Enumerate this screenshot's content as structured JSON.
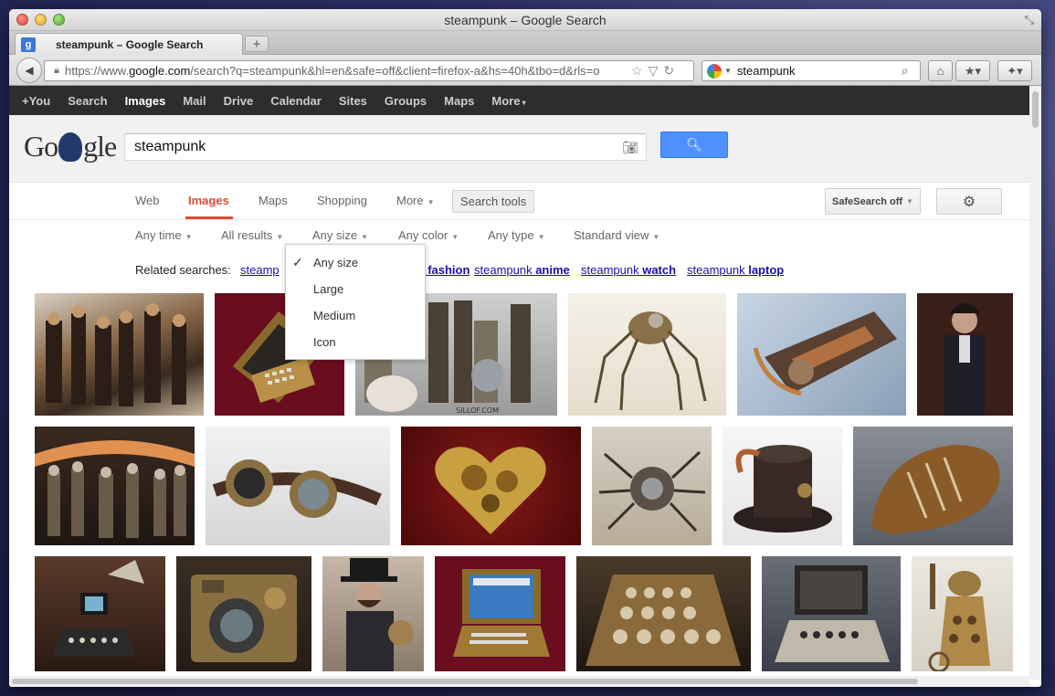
{
  "window": {
    "title": "steampunk – Google Search"
  },
  "tab": {
    "label": "steampunk – Google Search",
    "favicon": "g"
  },
  "navbar": {
    "url_prefix": "https://www.",
    "url_host": "google.com",
    "url_rest": "/search?q=steampunk&hl=en&safe=off&client=firefox-a&hs=40h&tbo=d&rls=o",
    "search_value": "steampunk"
  },
  "gbar": {
    "items": [
      "+You",
      "Search",
      "Images",
      "Mail",
      "Drive",
      "Calendar",
      "Sites",
      "Groups",
      "Maps",
      "More"
    ],
    "active": "Images"
  },
  "header": {
    "logo_pre": "Go",
    "logo_post": "gle",
    "query": "steampunk"
  },
  "searchnav": {
    "web": "Web",
    "images": "Images",
    "maps": "Maps",
    "shopping": "Shopping",
    "more": "More",
    "tools": "Search tools",
    "safesearch": "SafeSearch off"
  },
  "tools": {
    "time": "Any time",
    "results": "All results",
    "size": "Any size",
    "color": "Any color",
    "type": "Any type",
    "view": "Standard view"
  },
  "size_menu": {
    "items": [
      "Any size",
      "Large",
      "Medium",
      "Icon"
    ],
    "selected": "Any size"
  },
  "related": {
    "label": "Related searches:",
    "links": [
      {
        "pre": "steampunk ",
        "bold": "fashion"
      },
      {
        "pre": "steampunk ",
        "bold": "anime"
      },
      {
        "pre": "steampunk ",
        "bold": "watch"
      },
      {
        "pre": "steampunk ",
        "bold": "laptop"
      }
    ],
    "partial_first": "steamp"
  },
  "thumbnails": {
    "row1": [
      "steampunk costume group",
      "steampunk laptop",
      "steampunk action figures",
      "steampunk spider sculpture",
      "steampunk guitar",
      "steampunk gentleman portrait"
    ],
    "row2": [
      "steampunk party crowd",
      "steampunk goggles",
      "steampunk heart gears",
      "steampunk mechanical spider",
      "steampunk top hat",
      "steampunk shoe"
    ],
    "row3": [
      "steampunk computer",
      "steampunk camera",
      "steampunk man with hat",
      "steampunk laptop",
      "steampunk keyboard",
      "steampunk typewriter",
      "steampunk dalek"
    ],
    "watermark": "SILLOF.COM"
  },
  "colors": {
    "accent_red": "#dd4b39",
    "google_blue": "#4d90fe",
    "gbar_bg": "#2d2d2d",
    "link": "#1a0dab"
  }
}
